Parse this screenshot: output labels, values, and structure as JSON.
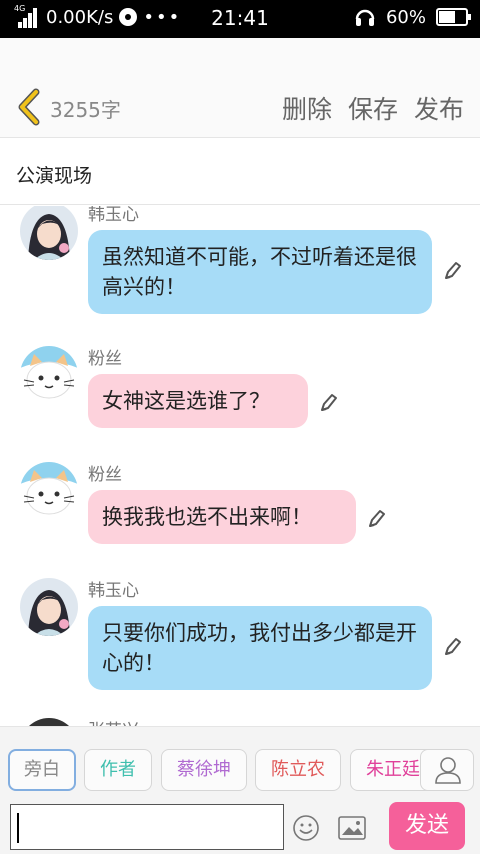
{
  "status": {
    "network_type": "4G",
    "speed": "0.00K/s",
    "extras": "•••",
    "time": "21:41",
    "battery_percent": "60%",
    "battery_level": 0.6
  },
  "header": {
    "word_count": "3255字",
    "delete_label": "删除",
    "save_label": "保存",
    "publish_label": "发布"
  },
  "scene_title": "公演现场",
  "messages": [
    {
      "sender": "韩玉心",
      "text": "虽然知道不可能，不过听着还是很高兴的！",
      "color": "blue"
    },
    {
      "sender": "粉丝",
      "text": "女神这是选谁了？",
      "color": "pink"
    },
    {
      "sender": "粉丝",
      "text": "换我我也选不出来啊！",
      "color": "pink"
    },
    {
      "sender": "韩玉心",
      "text": "只要你们成功，我付出多少都是开心的！",
      "color": "blue"
    },
    {
      "sender": "张艺兴",
      "text": "",
      "color": "blue"
    }
  ],
  "roles": [
    {
      "label": "旁白",
      "color": "#888888",
      "selected": true
    },
    {
      "label": "作者",
      "color": "#3fbfae",
      "selected": false
    },
    {
      "label": "蔡徐坤",
      "color": "#b06ad1",
      "selected": false
    },
    {
      "label": "陈立农",
      "color": "#e05a5a",
      "selected": false
    },
    {
      "label": "朱正廷",
      "color": "#e0409a",
      "selected": false
    }
  ],
  "composer": {
    "input_value": "",
    "send_label": "发送"
  },
  "colors": {
    "accent": "#f5609a",
    "bubble_blue": "#a7dcf7",
    "bubble_pink": "#fdd2dc",
    "back_arrow": "#f0c21b"
  },
  "icons": {
    "back": "chevron-left-icon",
    "edit": "pencil-icon",
    "emoji": "smiley-icon",
    "image": "image-icon",
    "contacts": "user-icon"
  }
}
